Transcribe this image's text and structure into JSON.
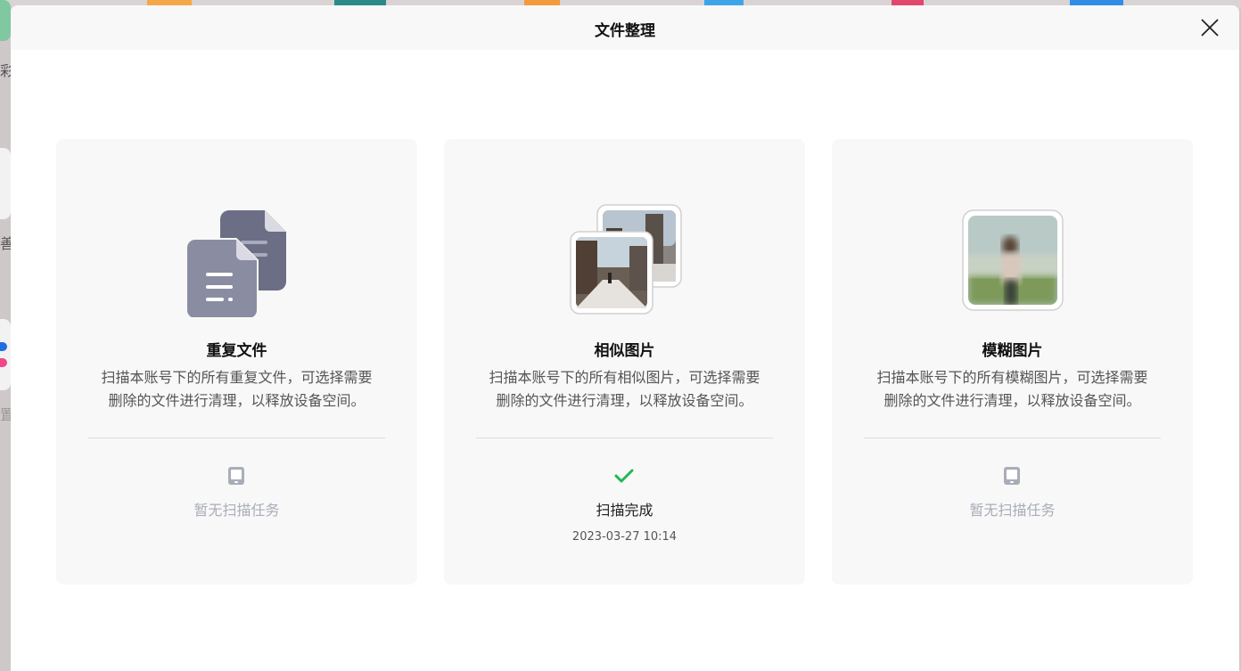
{
  "dialog": {
    "title": "文件整理"
  },
  "cards": [
    {
      "title": "重复文件",
      "desc_line1": "扫描本账号下的所有重复文件，可选择需要",
      "desc_line2": "删除的文件进行清理，以释放设备空间。",
      "status": "暂无扫描任务",
      "status_icon": "tablet-icon"
    },
    {
      "title": "相似图片",
      "desc_line1": "扫描本账号下的所有相似图片，可选择需要",
      "desc_line2": "删除的文件进行清理，以释放设备空间。",
      "status": "扫描完成",
      "status_time": "2023-03-27 10:14",
      "status_icon": "checkmark-icon"
    },
    {
      "title": "模糊图片",
      "desc_line1": "扫描本账号下的所有模糊图片，可选择需要",
      "desc_line2": "删除的文件进行清理，以释放设备空间。",
      "status": "暂无扫描任务",
      "status_icon": "tablet-icon"
    }
  ],
  "background": {
    "side_chars": [
      "彩",
      "善",
      "置"
    ]
  },
  "colors": {
    "success": "#1db954",
    "muted": "#a9adb8",
    "doc_icon_back": "#6b6e85",
    "doc_icon_front": "#8a8da2"
  }
}
